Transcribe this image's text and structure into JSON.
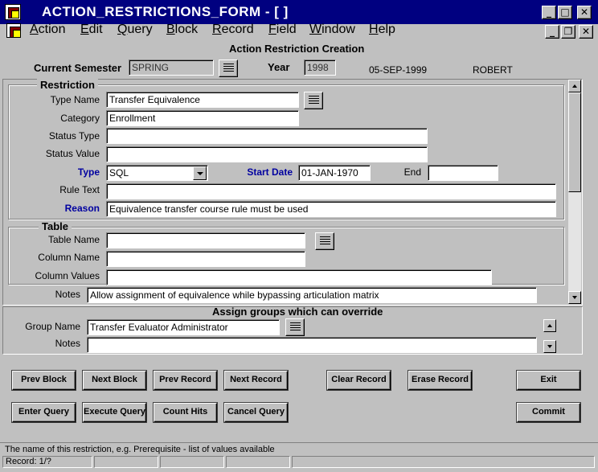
{
  "window": {
    "title": "ACTION_RESTRICTIONS_FORM - [ ]",
    "minimize_glyph": "_",
    "maximize_glyph": "□",
    "close_glyph": "✕",
    "restore_glyph": "❐"
  },
  "menu": {
    "items": [
      "Action",
      "Edit",
      "Query",
      "Block",
      "Record",
      "Field",
      "Window",
      "Help"
    ]
  },
  "form": {
    "heading": "Action Restriction Creation",
    "current_semester_label": "Current Semester",
    "current_semester_value": "SPRING",
    "year_label": "Year",
    "year_value": "1998",
    "date_text": "05-SEP-1999",
    "user_text": "ROBERT"
  },
  "restriction": {
    "section_title": "Restriction",
    "type_name_label": "Type Name",
    "type_name_value": "Transfer Equivalence",
    "category_label": "Category",
    "category_value": "Enrollment",
    "status_type_label": "Status Type",
    "status_type_value": "",
    "status_value_label": "Status Value",
    "status_value_value": "",
    "type_label": "Type",
    "type_value": "SQL",
    "start_date_label": "Start Date",
    "start_date_value": "01-JAN-1970",
    "end_label": "End",
    "end_value": "",
    "rule_text_label": "Rule Text",
    "rule_text_value": "",
    "reason_label": "Reason",
    "reason_value": "Equivalence transfer course rule must be used"
  },
  "table": {
    "section_title": "Table",
    "table_name_label": "Table Name",
    "table_name_value": "",
    "column_name_label": "Column Name",
    "column_name_value": "",
    "column_values_label": "Column Values",
    "column_values_value": ""
  },
  "notes": {
    "label": "Notes",
    "value": "Allow assignment of equivalence while bypassing articulation matrix"
  },
  "override": {
    "heading": "Assign groups which can override",
    "group_name_label": "Group Name",
    "group_name_value": "Transfer Evaluator Administrator",
    "notes_label": "Notes",
    "notes_value": ""
  },
  "buttons": {
    "prev_block": "Prev Block",
    "next_block": "Next Block",
    "prev_record": "Prev Record",
    "next_record": "Next Record",
    "clear_record": "Clear Record",
    "erase_record": "Erase Record",
    "exit": "Exit",
    "enter_query": "Enter Query",
    "execute_query": "Execute Query",
    "count_hits": "Count Hits",
    "cancel_query": "Cancel Query",
    "commit": "Commit"
  },
  "status": {
    "hint": "The name of this restriction, e.g.  Prerequisite - list of values available",
    "record": "Record: 1/?"
  }
}
